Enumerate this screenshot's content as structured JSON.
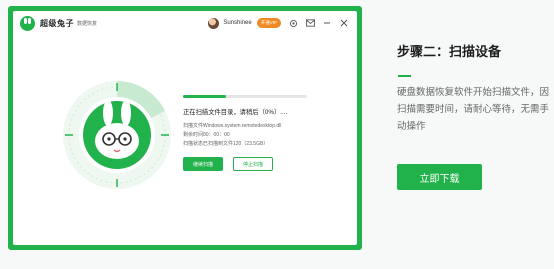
{
  "app": {
    "name": "超级兔子",
    "name_sub": "数据恢复",
    "username": "Sunshinee",
    "vip_label": "开通VIP"
  },
  "scan": {
    "progress_fraction": 0.35,
    "status_title": "正在扫描文件目录，请稍后（0%）....",
    "file_label": "扫描文件：",
    "file_value": "Windows.system.remotedesktop.dll",
    "time_label": "剩余时间：",
    "time_value": "00：00：00",
    "state_label": "扫描状态：",
    "state_value": "已扫描到文件120（23.5GB）",
    "pause_label": "继续扫描",
    "stop_label": "停止扫描"
  },
  "panel": {
    "step_title": "步骤二：扫描设备",
    "description": "硬盘数据恢复软件开始扫描文件，因扫描需要时间，请耐心等待，无需手动操作",
    "download_label": "立即下载"
  },
  "colors": {
    "brand_green": "#22b24c",
    "vip_orange": "#f08a24"
  },
  "icons": [
    "rabbit-logo-icon",
    "avatar",
    "settings-icon",
    "mail-icon",
    "minimize-icon",
    "close-icon",
    "rabbit-scan-illustration"
  ]
}
